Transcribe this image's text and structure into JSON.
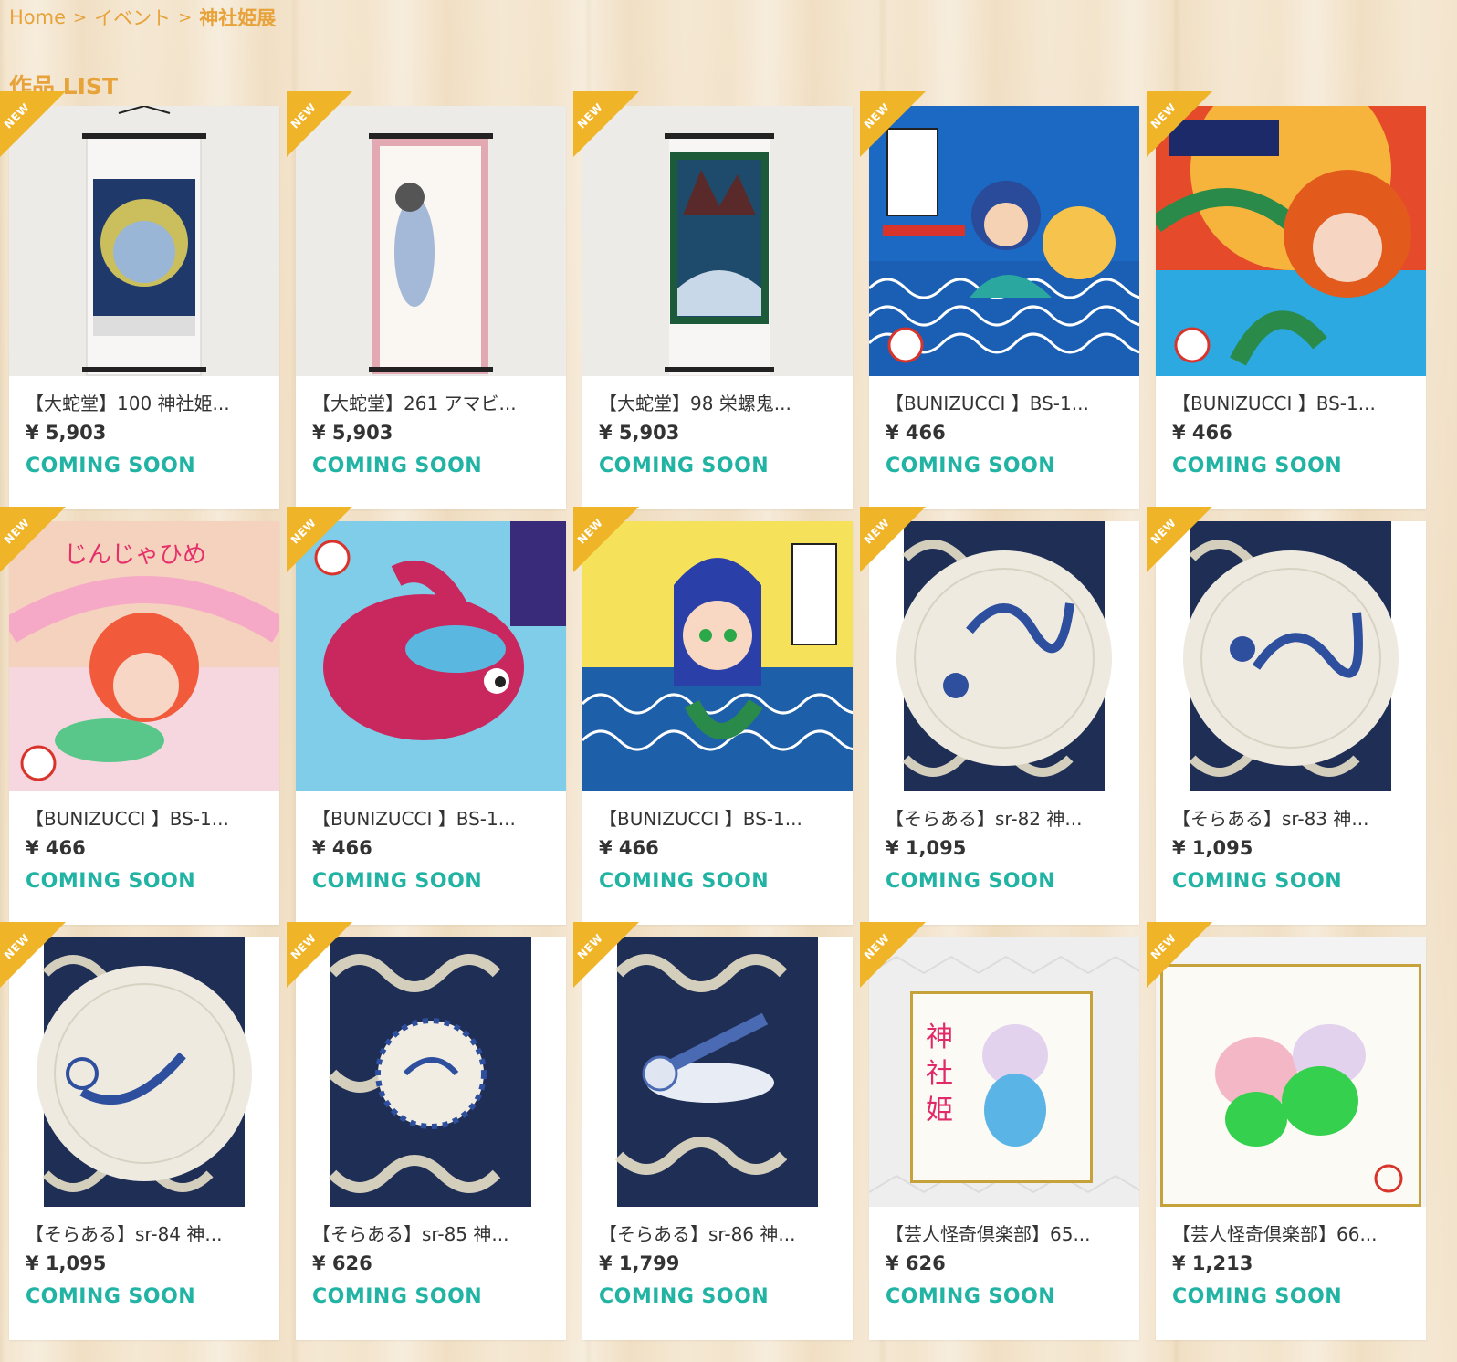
{
  "breadcrumb": {
    "home": "Home",
    "sep": ">",
    "event": "イベント",
    "current": "神社姫展"
  },
  "title": "作品 LIST",
  "ribbon_label": "NEW",
  "products": [
    {
      "name": "【大蛇堂】100 神社姫...",
      "price": "¥ 5,903",
      "status": "COMING SOON",
      "image": "scroll-art-1"
    },
    {
      "name": "【大蛇堂】261 アマビ...",
      "price": "¥ 5,903",
      "status": "COMING SOON",
      "image": "scroll-art-2"
    },
    {
      "name": "【大蛇堂】98 栄螺鬼...",
      "price": "¥ 5,903",
      "status": "COMING SOON",
      "image": "scroll-art-3"
    },
    {
      "name": "【BUNIZUCCI 】BS-1...",
      "price": "¥ 466",
      "status": "COMING SOON",
      "image": "sticker-art-1"
    },
    {
      "name": "【BUNIZUCCI 】BS-1...",
      "price": "¥ 466",
      "status": "COMING SOON",
      "image": "sticker-art-2"
    },
    {
      "name": "【BUNIZUCCI 】BS-1...",
      "price": "¥ 466",
      "status": "COMING SOON",
      "image": "sticker-art-3"
    },
    {
      "name": "【BUNIZUCCI 】BS-1...",
      "price": "¥ 466",
      "status": "COMING SOON",
      "image": "sticker-art-4"
    },
    {
      "name": "【BUNIZUCCI 】BS-1...",
      "price": "¥ 466",
      "status": "COMING SOON",
      "image": "sticker-art-5"
    },
    {
      "name": "【そらある】sr-82 神...",
      "price": "¥ 1,095",
      "status": "COMING SOON",
      "image": "plate-art-1"
    },
    {
      "name": "【そらある】sr-83 神...",
      "price": "¥ 1,095",
      "status": "COMING SOON",
      "image": "plate-art-2"
    },
    {
      "name": "【そらある】sr-84 神...",
      "price": "¥ 1,095",
      "status": "COMING SOON",
      "image": "plate-art-3"
    },
    {
      "name": "【そらある】sr-85 神...",
      "price": "¥ 626",
      "status": "COMING SOON",
      "image": "button-art"
    },
    {
      "name": "【そらある】sr-86 神...",
      "price": "¥ 1,799",
      "status": "COMING SOON",
      "image": "figurine-art"
    },
    {
      "name": "【芸人怪奇倶楽部】65...",
      "price": "¥ 626",
      "status": "COMING SOON",
      "image": "shikishi-art-1"
    },
    {
      "name": "【芸人怪奇倶楽部】66...",
      "price": "¥ 1,213",
      "status": "COMING SOON",
      "image": "shikishi-art-2"
    }
  ],
  "colors": {
    "accent": "#e8a23a",
    "ribbon": "#f0b429",
    "status": "#21b3a3"
  }
}
